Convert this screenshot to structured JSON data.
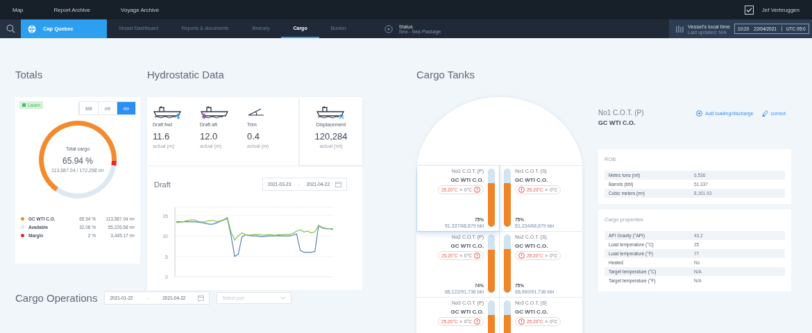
{
  "top_nav": {
    "links": [
      {
        "label": "Map"
      },
      {
        "label": "Report Archive"
      },
      {
        "label": "Voyage Archive"
      }
    ],
    "user": "Jef Verbruggen"
  },
  "vessel_nav": {
    "vessel": "Cap Quebec",
    "tabs": [
      {
        "label": "Vessel Dashboard",
        "selected": false
      },
      {
        "label": "Reports & documents",
        "selected": false
      },
      {
        "label": "Itinerary",
        "selected": false
      },
      {
        "label": "Cargo",
        "selected": true
      },
      {
        "label": "Bunker",
        "selected": false
      }
    ],
    "status": {
      "label": "Status",
      "value": "Sea - Sea Passage"
    },
    "local_time": {
      "label": "Vessel's local time",
      "updated": "Last updated: N/A",
      "time": "10:20",
      "date": "22/04/2021",
      "utc": "UTC 05:0"
    }
  },
  "totals": {
    "title": "Totals",
    "badge": "Laden",
    "units": [
      {
        "label": "bbl",
        "selected": false
      },
      {
        "label": "mt",
        "selected": false
      },
      {
        "label": "m³",
        "selected": true
      }
    ],
    "gauge_label": "Total cargo",
    "percent": "65.94 %",
    "amount": "113,587.04 / 172,258 m³",
    "chart_data": {
      "type": "donut",
      "values": [
        65.94,
        32.06,
        2
      ]
    },
    "legend": [
      {
        "name": "GC WTI C.O.",
        "color": "#f28a2e",
        "percent": "65.94 %",
        "amount": "113,587.04 m³"
      },
      {
        "name": "Available",
        "color": "#dde8f5",
        "percent": "32.06 %",
        "amount": "55,226.58 m³"
      },
      {
        "name": "Margin",
        "color": "#e8262a",
        "percent": "2 %",
        "amount": "3,445.17 m³"
      }
    ]
  },
  "hydrostatic": {
    "title": "Hydrostatic Data",
    "metrics": [
      {
        "kind": "fwd",
        "label": "Draft fwd",
        "value": "11.6",
        "unit": "actual (m)"
      },
      {
        "kind": "aft",
        "label": "Draft aft",
        "value": "12.0",
        "unit": "actual (m)"
      },
      {
        "kind": "trim",
        "label": "Trim",
        "value": "0.4",
        "unit": "actual (m)"
      }
    ],
    "displacement": {
      "label": "Displacement",
      "value": "120,284",
      "unit": "actual (mt)"
    },
    "draft": {
      "title": "Draft",
      "date_from": "2021-03-23",
      "arrow": "→",
      "date_to": "2021-04-22",
      "chart_data": {
        "type": "line",
        "ylim": [
          0,
          17
        ],
        "grid": true,
        "yticks": [
          0,
          5,
          10,
          15
        ],
        "series": [
          {
            "color": "#5a7bb5",
            "values": [
              13.5,
              13.5,
              13.5,
              13.5,
              13.5,
              13.5,
              13.4,
              13.3,
              13.1,
              12.9,
              12.9,
              13.2,
              13.6,
              13.9,
              14.3,
              10.2,
              5,
              5.5,
              9.8,
              10.3,
              10.1,
              10,
              10,
              9.9,
              9.9,
              10,
              10,
              10,
              10.1,
              10,
              10,
              10,
              10.2,
              10.5,
              6.5,
              6,
              6,
              6,
              6.2,
              12.5,
              12,
              11.8,
              11.8,
              11.7
            ]
          },
          {
            "color": "#7cc44e",
            "values": [
              13.3,
              13.4,
              13.5,
              13.8,
              13.9,
              13.9,
              13.6,
              13.4,
              13.5,
              13.8,
              13.8,
              13.5,
              13.7,
              14,
              14.5,
              11,
              9,
              10,
              10.8,
              10.3,
              10.2,
              10.3,
              10.4,
              10.3,
              10.2,
              10.3,
              10.3,
              10.2,
              10.3,
              10.3,
              10.4,
              10.4,
              10.6,
              11.2,
              11.5,
              11,
              11.2,
              10.8,
              11,
              12.6,
              12.1,
              11.9,
              11.8,
              11.6
            ]
          }
        ]
      }
    }
  },
  "cargo_operations": {
    "title": "Cargo Operations",
    "date_from": "2021-01-22",
    "arrow": "→",
    "date_to": "2021-04-22",
    "port_placeholder": "Select port"
  },
  "cargo_tanks": {
    "title": "Cargo Tanks",
    "tanks": [
      {
        "name": "No1 C.O.T. (P)",
        "cargo": "GC WTI C.O.",
        "temperature": "25.20°C",
        "arrow": "»",
        "target": "0°C",
        "percent": "75%",
        "volume": "51,337/68,879 bbl",
        "level": 0.75,
        "selected": true
      },
      {
        "name": "No1 C.O.T. (S)",
        "cargo": "GC WTI C.O.",
        "temperature": "25.20°C",
        "arrow": "»",
        "target": "0°C",
        "percent": "75%",
        "volume": "51,234/68,879 bbl",
        "level": 0.75,
        "selected": false
      },
      {
        "name": "No2 C.O.T. (P)",
        "cargo": "GC WTI C.O.",
        "temperature": "25.20°C",
        "arrow": "»",
        "target": "0°C",
        "percent": "74%",
        "volume": "68,122/91,736 bbl",
        "level": 0.74,
        "selected": false
      },
      {
        "name": "No2 C.O.T. (S)",
        "cargo": "GC WTI C.O.",
        "temperature": "25.20°C",
        "arrow": "»",
        "target": "0°C",
        "percent": "75%",
        "volume": "68,990/91,736 bbl",
        "level": 0.75,
        "selected": false
      },
      {
        "name": "No3 C.O.T. (P)",
        "cargo": "GC WTI C.O.",
        "temperature": "25.20°C",
        "arrow": "»",
        "target": "0°C",
        "level": 0.75,
        "selected": false
      },
      {
        "name": "No3 C.O.T. (S)",
        "cargo": "GC WTI C.O.",
        "temperature": "25.20°C",
        "arrow": "»",
        "target": "0°C",
        "level": 0.75,
        "selected": false
      }
    ]
  },
  "tank_details": {
    "tank": "No1 C.O.T. (P)",
    "cargo": "GC WTI C.O.",
    "actions": [
      {
        "kind": "add",
        "label": "Add loading/discharge"
      },
      {
        "kind": "edit",
        "label": "correct"
      }
    ],
    "sections": [
      {
        "title": "ROB",
        "rows": [
          {
            "label": "Metric tons (mt)",
            "value": "6,536"
          },
          {
            "label": "Barrels (bbl)",
            "value": "51,337"
          },
          {
            "label": "Cubic meters (m³)",
            "value": "8,161.93"
          }
        ]
      },
      {
        "title": "Cargo properties",
        "rows": [
          {
            "label": "API Gravity (°API)",
            "value": "43.2"
          },
          {
            "label": "Load temperature (°C)",
            "value": "25"
          },
          {
            "label": "Load temperature (°F)",
            "value": "77"
          },
          {
            "label": "Heated",
            "value": "No"
          },
          {
            "label": "Target temperature (°C)",
            "value": "N/A"
          },
          {
            "label": "Target temperature (°F)",
            "value": "N/A"
          }
        ]
      }
    ]
  }
}
